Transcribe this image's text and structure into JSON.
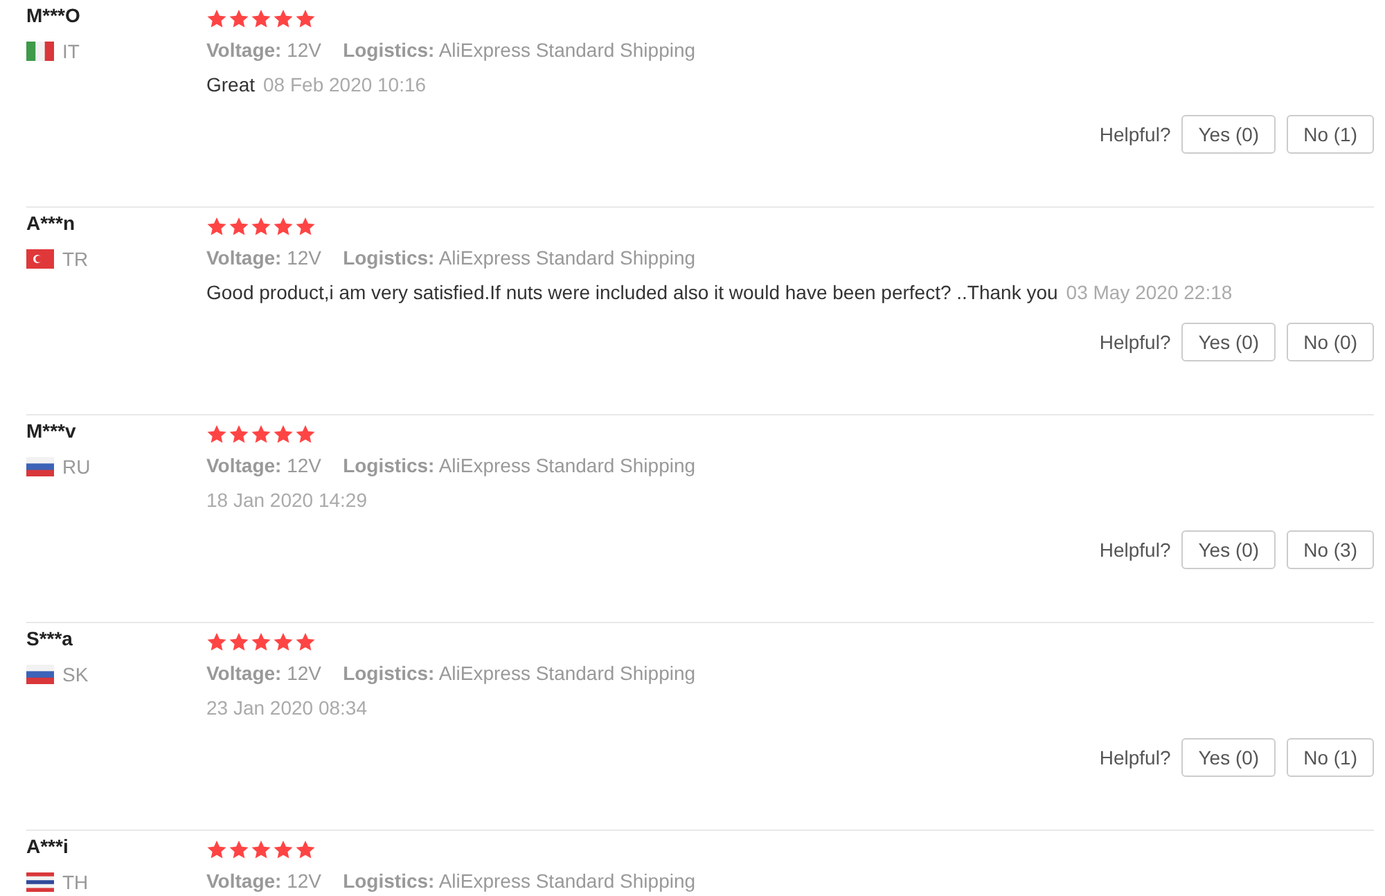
{
  "reviews": [
    {
      "name": "M***O",
      "country": "IT",
      "stars": 5,
      "voltage_label": "Voltage:",
      "voltage": "12V",
      "logistics_label": "Logistics:",
      "logistics": "AliExpress Standard Shipping",
      "comment": "Great",
      "date": "08 Feb 2020 10:16",
      "helpful_label": "Helpful?",
      "yes": "Yes (0)",
      "no": "No (1)"
    },
    {
      "name": "A***n",
      "country": "TR",
      "stars": 5,
      "voltage_label": "Voltage:",
      "voltage": "12V",
      "logistics_label": "Logistics:",
      "logistics": "AliExpress Standard Shipping",
      "comment": "Good product,i am very satisfied.If nuts were included also it would have been perfect? ..Thank you",
      "date": "03 May 2020 22:18",
      "helpful_label": "Helpful?",
      "yes": "Yes (0)",
      "no": "No (0)"
    },
    {
      "name": "M***v",
      "country": "RU",
      "stars": 5,
      "voltage_label": "Voltage:",
      "voltage": "12V",
      "logistics_label": "Logistics:",
      "logistics": "AliExpress Standard Shipping",
      "date": "18 Jan 2020 14:29",
      "helpful_label": "Helpful?",
      "yes": "Yes (0)",
      "no": "No (3)"
    },
    {
      "name": "S***a",
      "country": "SK",
      "stars": 5,
      "voltage_label": "Voltage:",
      "voltage": "12V",
      "logistics_label": "Logistics:",
      "logistics": "AliExpress Standard Shipping",
      "date": "23 Jan 2020 08:34",
      "helpful_label": "Helpful?",
      "yes": "Yes (0)",
      "no": "No (1)"
    },
    {
      "name": "A***i",
      "country": "TH",
      "stars": 5,
      "voltage_label": "Voltage:",
      "voltage": "12V",
      "logistics_label": "Logistics:",
      "logistics": "AliExpress Standard Shipping"
    }
  ]
}
